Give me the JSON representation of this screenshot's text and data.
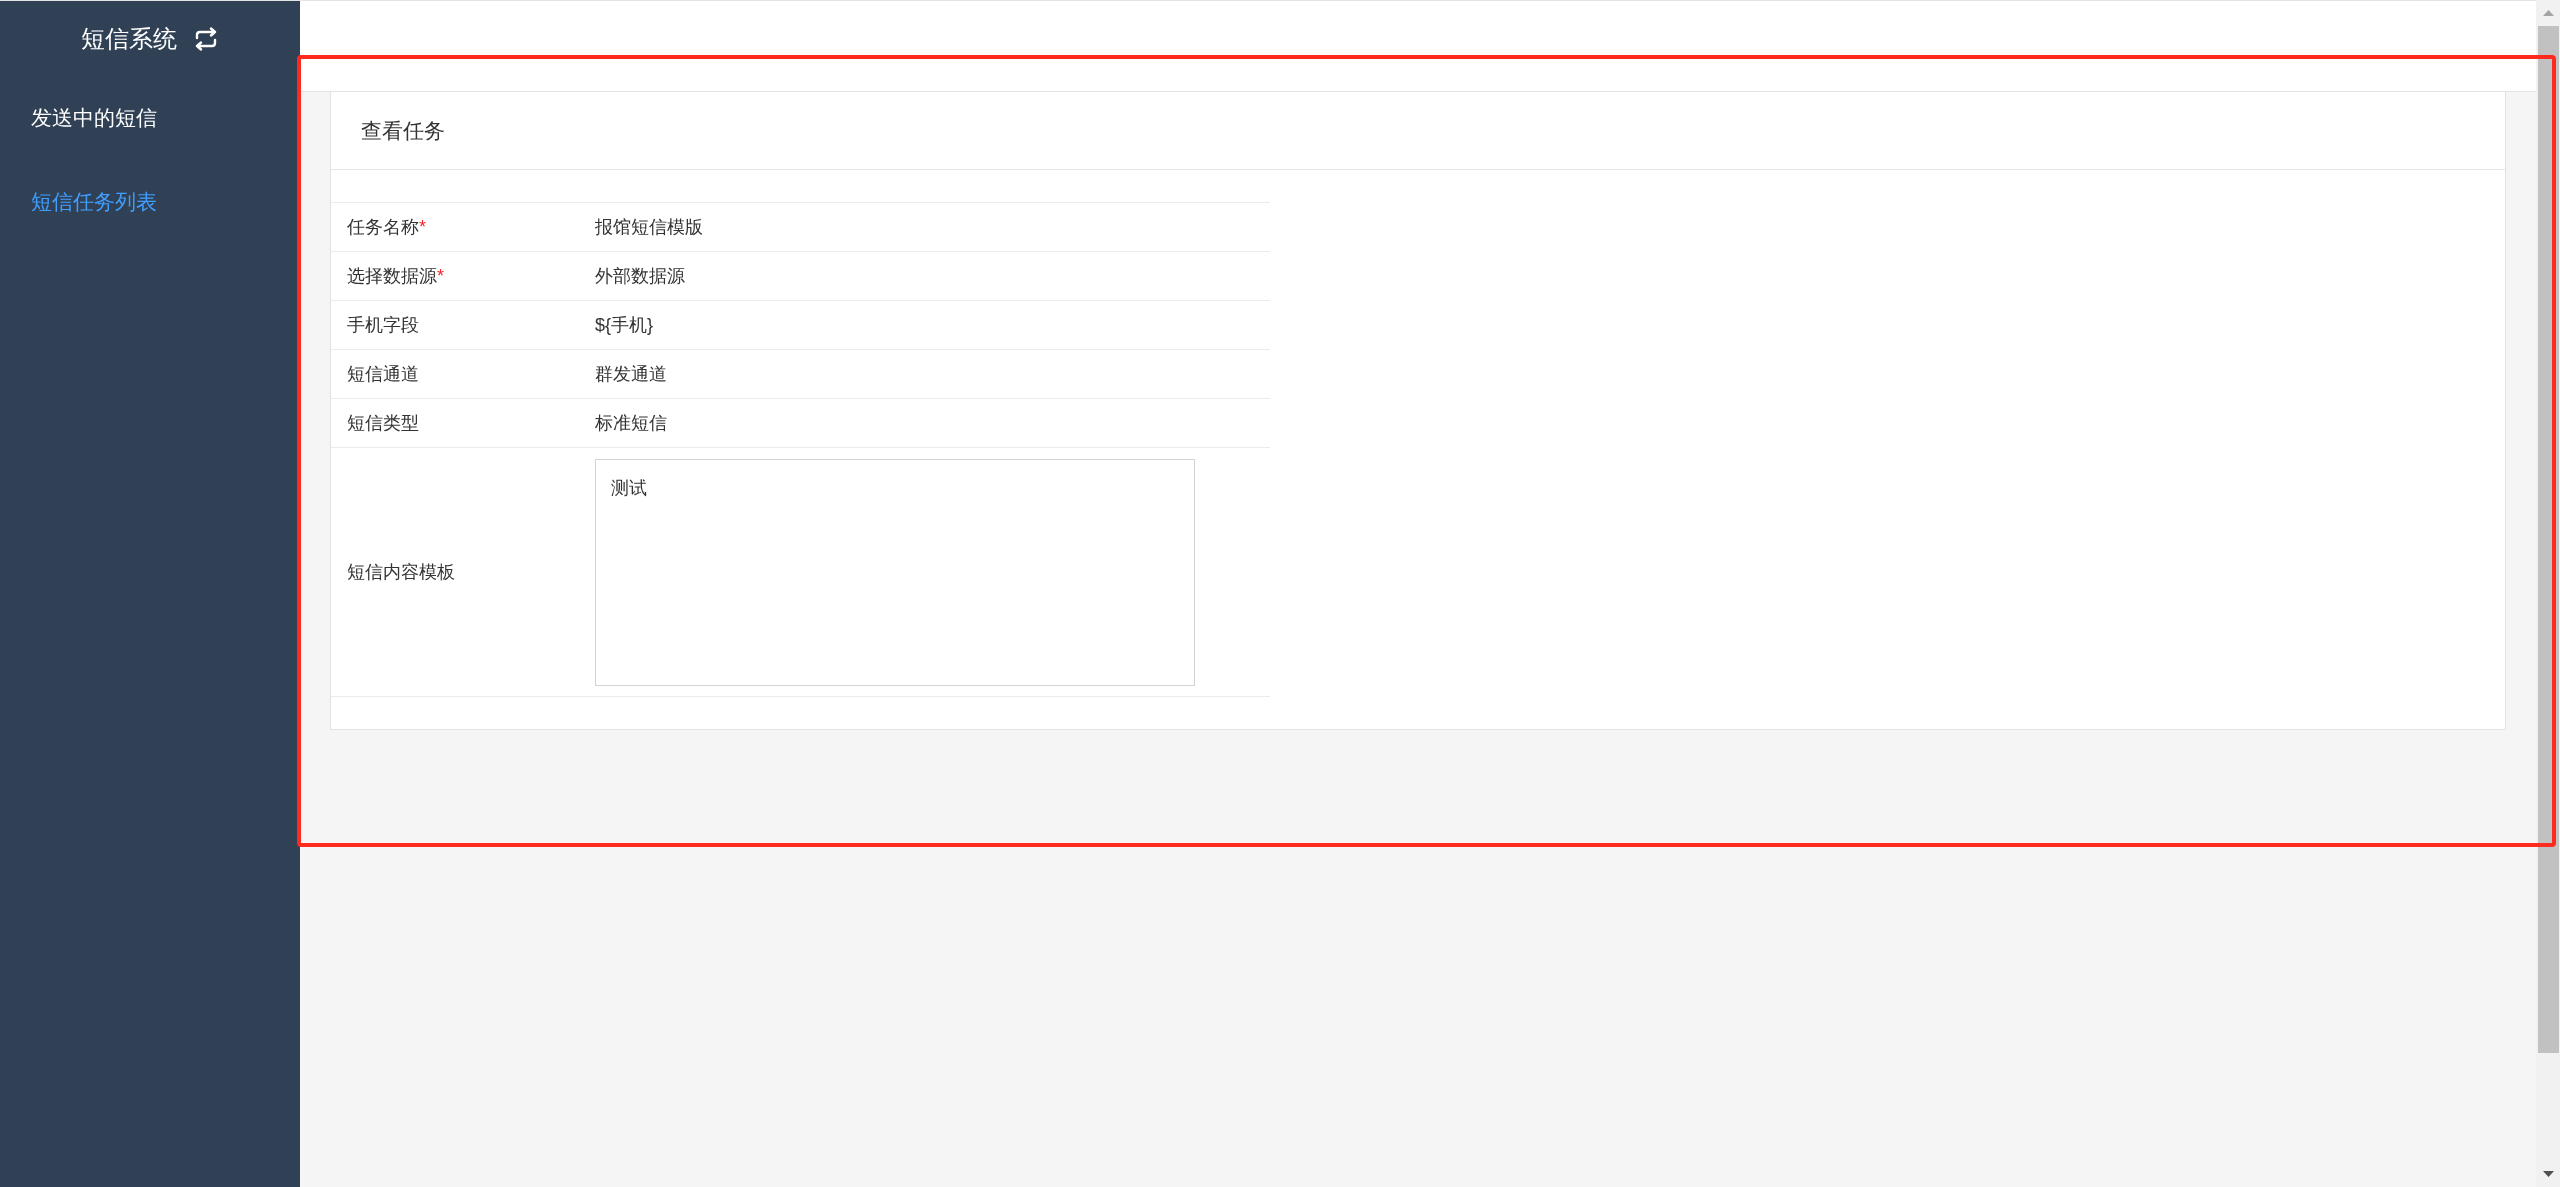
{
  "sidebar": {
    "title": "短信系统",
    "items": [
      {
        "label": "发送中的短信",
        "selected": false
      },
      {
        "label": "短信任务列表",
        "selected": true
      }
    ]
  },
  "card": {
    "title": "查看任务",
    "required_mark": "*",
    "fields": [
      {
        "kind": "text",
        "label": "任务名称",
        "required": true,
        "value": "报馆短信模版"
      },
      {
        "kind": "text",
        "label": "选择数据源",
        "required": true,
        "value": "外部数据源"
      },
      {
        "kind": "text",
        "label": "手机字段",
        "required": false,
        "value": "${手机}"
      },
      {
        "kind": "text",
        "label": "短信通道",
        "required": false,
        "value": "群发通道"
      },
      {
        "kind": "text",
        "label": "短信类型",
        "required": false,
        "value": "标准短信"
      },
      {
        "kind": "textarea",
        "label": "短信内容模板",
        "required": false,
        "value": "测试"
      }
    ]
  }
}
